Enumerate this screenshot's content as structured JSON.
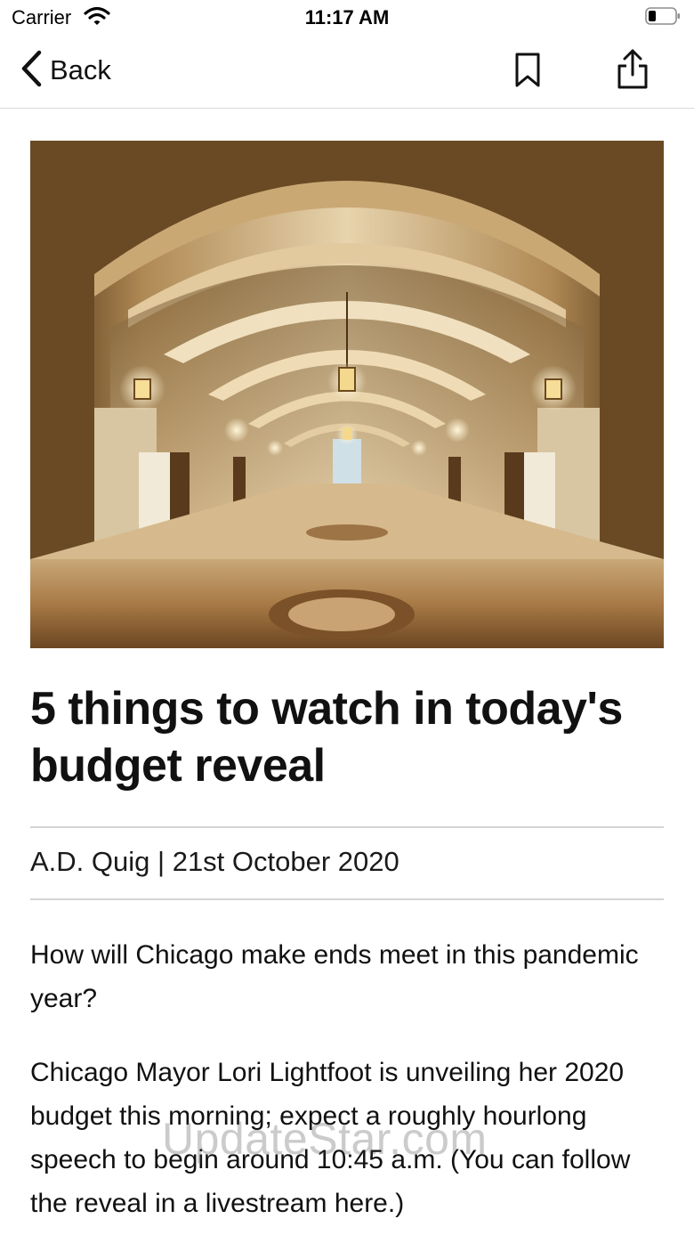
{
  "status": {
    "carrier": "Carrier",
    "time": "11:17 AM"
  },
  "nav": {
    "back_label": "Back"
  },
  "article": {
    "headline": "5 things to watch in today's budget reveal",
    "author": "A.D. Quig",
    "separator": "|",
    "date": "21st October 2020",
    "lead": "How will Chicago make ends meet in this pandemic year?",
    "body": "Chicago Mayor Lori Lightfoot is unveiling her 2020 budget this morning; expect a roughly hourlong speech to begin around 10:45 a.m. (You can follow the reveal in a livestream here.)"
  },
  "watermark": "UpdateStar.com",
  "colors": {
    "text": "#111111",
    "divider": "#d4d4d4",
    "nav_border": "#d9d9d9"
  },
  "icons": [
    "wifi-icon",
    "battery-icon",
    "chevron-left-icon",
    "bookmark-icon",
    "share-icon"
  ]
}
